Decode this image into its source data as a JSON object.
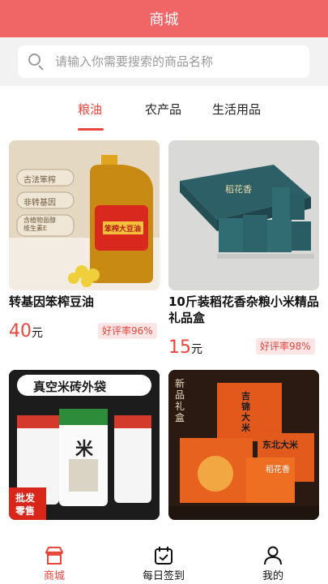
{
  "header": {
    "title": "商城"
  },
  "search": {
    "placeholder": "请输入你需要搜索的商品名称"
  },
  "tabs": [
    {
      "label": "粮油",
      "active": true
    },
    {
      "label": "农产品",
      "active": false
    },
    {
      "label": "生活用品",
      "active": false
    }
  ],
  "products": [
    {
      "name": "转基因笨榨豆油",
      "price": "40",
      "unit": "元",
      "rating": "好评率96%",
      "image_text": {
        "badge_1": "古法笨榨",
        "badge_2": "非转基因",
        "badge_3": "含植物甾醇\n维生素E",
        "bottle": "笨榨大豆油"
      }
    },
    {
      "name": "10斤装稻花香杂粮小米精品礼品盒",
      "price": "15",
      "unit": "元",
      "rating": "好评率98%",
      "image_text": {
        "box": "稻花香"
      }
    },
    {
      "name": "",
      "price": "",
      "unit": "",
      "rating": "",
      "image_text": {
        "banner": "真空米砖外袋",
        "corner": "批发\n零售",
        "bag": "米"
      }
    },
    {
      "name": "",
      "price": "",
      "unit": "",
      "rating": "",
      "image_text": {
        "left": "新品礼盒",
        "box_1": "吉锦大米",
        "box_2": "东北大米",
        "box_3": "稻花香"
      }
    }
  ],
  "tabbar": [
    {
      "label": "商城",
      "icon": "shop-icon",
      "active": true
    },
    {
      "label": "每日签到",
      "icon": "calendar-icon",
      "active": false
    },
    {
      "label": "我的",
      "icon": "user-icon",
      "active": false
    }
  ],
  "colors": {
    "brand": "#f06565",
    "accent": "#e8473e",
    "rating_bg": "#fde5e5"
  }
}
